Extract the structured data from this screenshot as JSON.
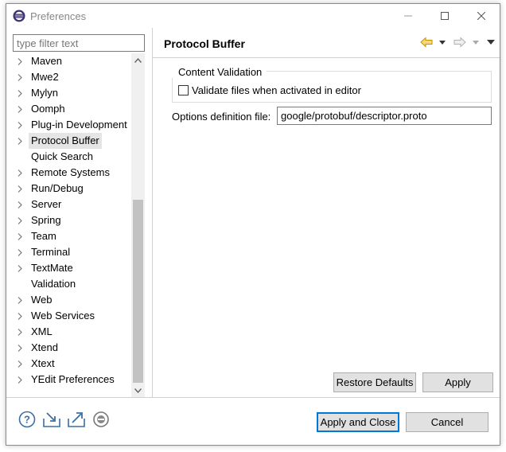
{
  "window": {
    "title": "Preferences"
  },
  "filter": {
    "placeholder": "type filter text",
    "value": ""
  },
  "tree": {
    "items": [
      {
        "label": "Maven",
        "expandable": true
      },
      {
        "label": "Mwe2",
        "expandable": true
      },
      {
        "label": "Mylyn",
        "expandable": true
      },
      {
        "label": "Oomph",
        "expandable": true
      },
      {
        "label": "Plug-in Development",
        "expandable": true
      },
      {
        "label": "Protocol Buffer",
        "expandable": true,
        "selected": true
      },
      {
        "label": "Quick Search",
        "expandable": false
      },
      {
        "label": "Remote Systems",
        "expandable": true
      },
      {
        "label": "Run/Debug",
        "expandable": true
      },
      {
        "label": "Server",
        "expandable": true
      },
      {
        "label": "Spring",
        "expandable": true
      },
      {
        "label": "Team",
        "expandable": true
      },
      {
        "label": "Terminal",
        "expandable": true
      },
      {
        "label": "TextMate",
        "expandable": true
      },
      {
        "label": "Validation",
        "expandable": false
      },
      {
        "label": "Web",
        "expandable": true
      },
      {
        "label": "Web Services",
        "expandable": true
      },
      {
        "label": "XML",
        "expandable": true
      },
      {
        "label": "Xtend",
        "expandable": true
      },
      {
        "label": "Xtext",
        "expandable": true
      },
      {
        "label": "YEdit Preferences",
        "expandable": true
      }
    ]
  },
  "page": {
    "title": "Protocol Buffer",
    "group_title": "Content Validation",
    "validate_label": "Validate files when activated in editor",
    "validate_checked": false,
    "options_label": "Options definition file:",
    "options_value": "google/protobuf/descriptor.proto",
    "restore_defaults": "Restore Defaults",
    "apply": "Apply"
  },
  "footer": {
    "apply_and_close": "Apply and Close",
    "cancel": "Cancel"
  },
  "colors": {
    "accent": "#0078d7",
    "back_arrow": "#e8a600",
    "selection": "#e5e5e5"
  }
}
